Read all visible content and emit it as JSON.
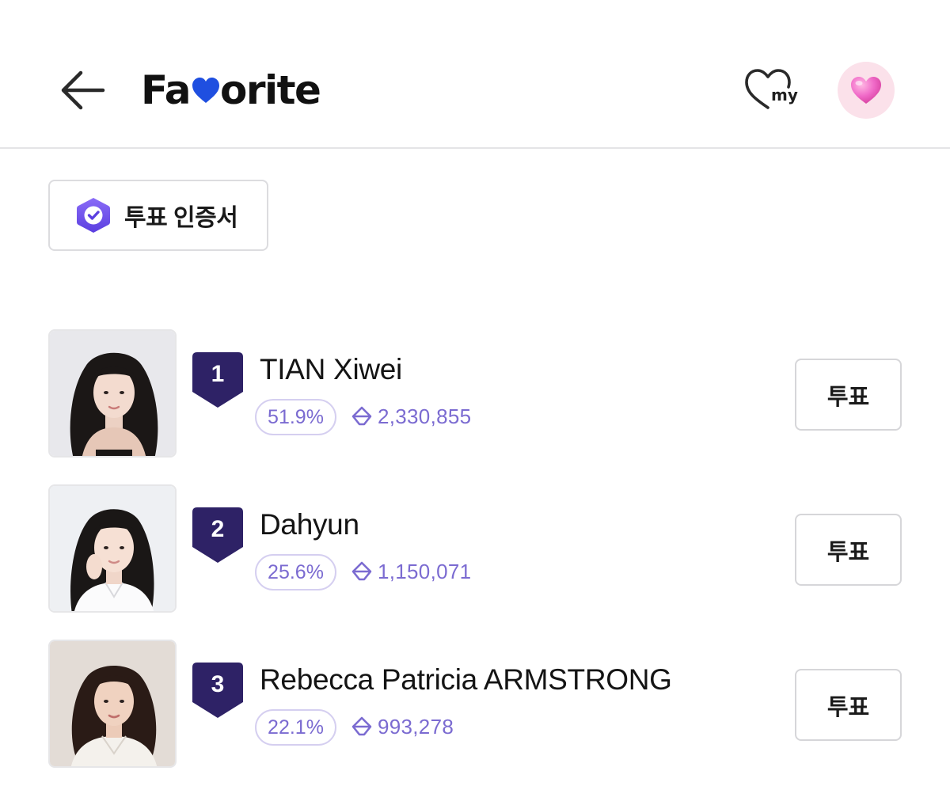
{
  "header": {
    "back_icon": "arrow-left-icon",
    "brand_prefix": "Fa",
    "brand_heart_icon": "heart-icon",
    "brand_heart_color": "#1f4fe0",
    "brand_suffix": "orite",
    "my_label": "my",
    "my_icon": "heart-outline-icon",
    "fav_icon": "pink-heart-icon",
    "fav_bg_color": "#fbe1ea"
  },
  "certificate": {
    "icon": "verified-badge-icon",
    "label": "투표 인증서",
    "icon_color": "#6a4ff0"
  },
  "accent_color": "#7b6bd1",
  "rank_badge_color": "#2e2266",
  "rankings": [
    {
      "rank": "1",
      "name": "TIAN Xiwei",
      "percent": "51.9%",
      "votes": "2,330,855",
      "vote_button": "투표"
    },
    {
      "rank": "2",
      "name": "Dahyun",
      "percent": "25.6%",
      "votes": "1,150,071",
      "vote_button": "투표"
    },
    {
      "rank": "3",
      "name": "Rebecca Patricia ARMSTRONG",
      "percent": "22.1%",
      "votes": "993,278",
      "vote_button": "투표"
    }
  ]
}
